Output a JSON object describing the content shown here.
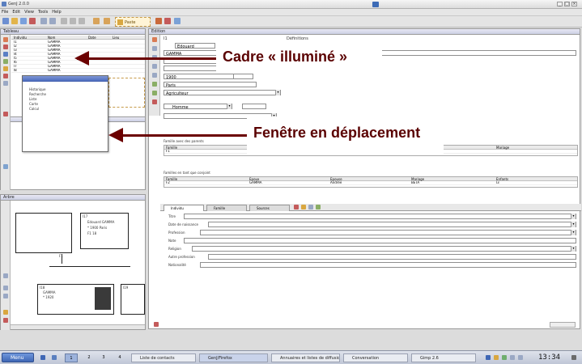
{
  "window": {
    "title": "GenJ 2.0.0",
    "min_glyph": "_",
    "max_glyph": "□",
    "close_glyph": "×"
  },
  "menubar": [
    "File",
    "Edit",
    "View",
    "Tools",
    "Help"
  ],
  "toolbar": {
    "active_label": "Paste"
  },
  "panels": {
    "table": {
      "title": "Tableau"
    },
    "edit": {
      "title": "Edition"
    },
    "tree": {
      "title": "Arbre"
    },
    "floating": {
      "title": ""
    }
  },
  "table": {
    "headers": [
      "Individu",
      "Nom",
      "Date",
      "Lieu"
    ],
    "rows": [
      [
        "I1",
        "GAMMA",
        "",
        ""
      ],
      [
        "I2",
        "GAMMA",
        "",
        ""
      ],
      [
        "I3",
        "GAMMA",
        "",
        ""
      ],
      [
        "I4",
        "GAMMA",
        "",
        ""
      ],
      [
        "I5",
        "GAMMA",
        "",
        ""
      ],
      [
        "I6",
        "GAMMA",
        "",
        ""
      ],
      [
        "I7",
        "GAMMA",
        "",
        ""
      ],
      [
        "I8",
        "GAMMA",
        "",
        ""
      ]
    ]
  },
  "floating_window": {
    "lines": [
      "Historique",
      "Recherche",
      "Liste",
      "Carte",
      "Calcul"
    ]
  },
  "edit": {
    "header_left": "I1",
    "header_right": "Définitions",
    "name_value": "Edouard",
    "surname_value": "GAMMA",
    "date_value": "1900",
    "place_value": "Paris",
    "occupation_value": "Agriculteur",
    "sex_value": "Homme",
    "notes_value": "",
    "section1_title": "Famille avec des parents",
    "section1_cols": [
      "Famille",
      "Epoux",
      "Epouse",
      "Mariage"
    ],
    "section1_row": [
      "F1",
      "",
      "",
      ""
    ],
    "section2_title": "Familles en tant que conjoint",
    "section2_cols": [
      "Famille",
      "Epoux",
      "Epouse",
      "Mariage",
      "Enfants"
    ],
    "section2_row": [
      "F2",
      "GAMMA",
      "Andrée",
      "BETA",
      "I3"
    ],
    "tabs": [
      "Individu",
      "Famille",
      "Sources"
    ],
    "properties": [
      {
        "label": "Titre",
        "value": ""
      },
      {
        "label": "Date de naissance",
        "value": ""
      },
      {
        "label": "Profession",
        "value": ""
      },
      {
        "label": "Note",
        "value": ""
      },
      {
        "label": "Religion",
        "value": ""
      },
      {
        "label": "Autre profession",
        "value": ""
      },
      {
        "label": "Nationalité",
        "value": ""
      }
    ]
  },
  "tree": {
    "boxes": [
      {
        "id": "I17",
        "line1": "Edouard GAMMA",
        "line2": "* 1900 Paris",
        "line3": "F1 18"
      },
      {
        "id": "I18",
        "line1": "GAMMA",
        "line2": "* 1920",
        "line3": ""
      },
      {
        "id": "I19",
        "line1": "",
        "line2": "",
        "line3": ""
      },
      {
        "id": "I20",
        "line1": "",
        "line2": "",
        "line3": ""
      }
    ],
    "bottom_label": "F1"
  },
  "annotations": {
    "cadre": "Cadre « illuminé »",
    "fenetre": "Fenêtre en déplacement"
  },
  "taskbar": {
    "start_label": "Menu",
    "desktops": [
      "1",
      "2",
      "3",
      "4"
    ],
    "tasks": [
      "Liste de contacts",
      "GenJ/Firefox",
      "Annuaires et listes de diffusion",
      "Conversation",
      "Gimp 2.6"
    ],
    "clock": "13:34"
  },
  "colors": {
    "accent": "#5a0000",
    "panel_title": "#ccd0e4",
    "highlight": "#fff4d6"
  }
}
